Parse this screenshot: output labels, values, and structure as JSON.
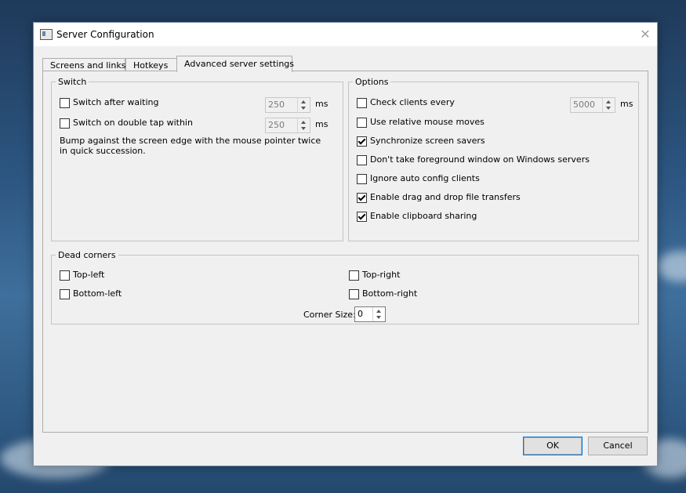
{
  "window": {
    "title": "Server Configuration",
    "icon": "app-window-icon",
    "close_icon": "close-icon"
  },
  "tabs": [
    {
      "label": "Screens and links",
      "active": false
    },
    {
      "label": "Hotkeys",
      "active": false
    },
    {
      "label": "Advanced server settings",
      "active": true
    }
  ],
  "switch_group": {
    "legend": "Switch",
    "after_waiting": {
      "label": "Switch after waiting",
      "checked": false,
      "value": "250",
      "unit": "ms"
    },
    "double_tap": {
      "label": "Switch on double tap within",
      "checked": false,
      "value": "250",
      "unit": "ms"
    },
    "description": "Bump against the screen edge with the mouse pointer twice in quick succession."
  },
  "options_group": {
    "legend": "Options",
    "check_clients": {
      "label": "Check clients every",
      "checked": false,
      "value": "5000",
      "unit": "ms"
    },
    "items": [
      {
        "label": "Use relative mouse moves",
        "checked": false
      },
      {
        "label": "Synchronize screen savers",
        "checked": true
      },
      {
        "label": "Don't take foreground window on Windows servers",
        "checked": false
      },
      {
        "label": "Ignore auto config clients",
        "checked": false
      },
      {
        "label": "Enable drag and drop file transfers",
        "checked": true
      },
      {
        "label": "Enable clipboard sharing",
        "checked": true
      }
    ]
  },
  "dead_corners": {
    "legend": "Dead corners",
    "top_left": {
      "label": "Top-left",
      "checked": false
    },
    "top_right": {
      "label": "Top-right",
      "checked": false
    },
    "bottom_left": {
      "label": "Bottom-left",
      "checked": false
    },
    "bottom_right": {
      "label": "Bottom-right",
      "checked": false
    },
    "corner_size": {
      "label": "Corner Size:",
      "value": "0"
    }
  },
  "buttons": {
    "ok": "OK",
    "cancel": "Cancel"
  }
}
